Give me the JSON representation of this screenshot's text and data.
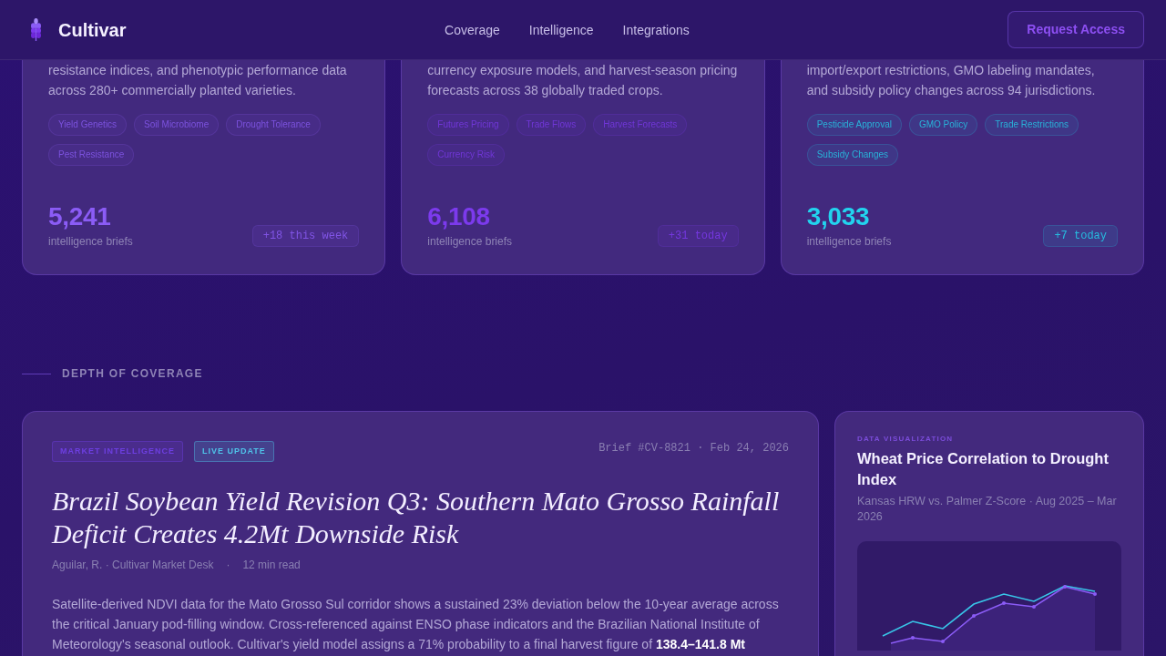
{
  "navbar": {
    "brand": "Cultivar",
    "links": [
      {
        "label": "Coverage"
      },
      {
        "label": "Intelligence"
      },
      {
        "label": "Integrations"
      }
    ],
    "cta": "Request Access"
  },
  "coverage_cards": [
    {
      "description": "resistance indices, and phenotypic performance data across 280+ commercially planted varieties.",
      "color": "#8b5cf6",
      "tags": [
        "Yield Genetics",
        "Soil Microbiome",
        "Drought Tolerance",
        "Pest Resistance"
      ],
      "count": "5,241",
      "count_label": "intelligence briefs",
      "delta": "+18 this week"
    },
    {
      "description": "currency exposure models, and harvest-season pricing forecasts across 38 globally traded crops.",
      "color": "#7c3aed",
      "tags": [
        "Futures Pricing",
        "Trade Flows",
        "Harvest Forecasts",
        "Currency Risk"
      ],
      "count": "6,108",
      "count_label": "intelligence briefs",
      "delta": "+31 today"
    },
    {
      "description": "import/export restrictions, GMO labeling mandates, and subsidy policy changes across 94 jurisdictions.",
      "color": "#22d3ee",
      "tags": [
        "Pesticide Approval",
        "GMO Policy",
        "Trade Restrictions",
        "Subsidy Changes"
      ],
      "count": "3,033",
      "count_label": "intelligence briefs",
      "delta": "+7 today"
    }
  ],
  "section_label": "DEPTH OF COVERAGE",
  "featured_brief": {
    "badges": [
      {
        "label": "MARKET INTELLIGENCE",
        "color": "#6d3fe0"
      },
      {
        "label": "LIVE UPDATE",
        "color": "#4fc3e8"
      }
    ],
    "meta": "Brief #CV-8821 · Feb 24, 2026",
    "title": "Brazil Soybean Yield Revision Q3: Southern Mato Grosso Rainfall Deficit Creates 4.2Mt Downside Risk",
    "byline": "Aguilar, R. · Cultivar Market Desk",
    "byline_separator": "·",
    "read_time": "12 min read",
    "body": "Satellite-derived NDVI data for the Mato Grosso Sul corridor shows a sustained 23% deviation below the 10-year average across the critical January pod-filling window. Cross-referenced against ENSO phase indicators and the Brazilian National Institute of Meteorology's seasonal outlook. Cultivar's yield model assigns a 71% probability to a final harvest figure of **138.4–141.8 Mt**"
  },
  "chart_card": {
    "eyebrow": "DATA VISUALIZATION",
    "title": "Wheat Price Correlation to Drought Index",
    "subtitle": "Kansas HRW vs. Palmer Z-Score · Aug 2025 – Mar 2026"
  }
}
